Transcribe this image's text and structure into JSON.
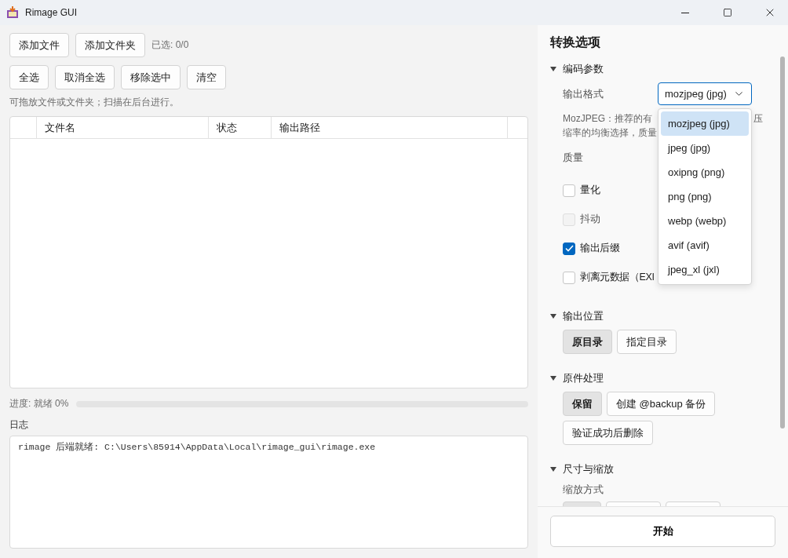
{
  "window": {
    "title": "Rimage GUI"
  },
  "file_toolbar": {
    "buttons": [
      "添加文件",
      "添加文件夹"
    ],
    "selection_count": "已选: 0/0"
  },
  "selection_toolbar": {
    "buttons": [
      "全选",
      "取消全选",
      "移除选中",
      "清空"
    ]
  },
  "hint": "可拖放文件或文件夹；扫描在后台进行。",
  "table": {
    "columns": [
      "文件名",
      "状态",
      "输出路径"
    ]
  },
  "progress": {
    "label": "进度: 就绪 0%",
    "level": 0
  },
  "log": {
    "label": "日志",
    "lines": [
      "rimage 后端就绪: C:\\Users\\85914\\AppData\\Local\\rimage_gui\\rimage.exe"
    ]
  },
  "options": {
    "title": "转换选项",
    "encoding": {
      "title": "编码参数",
      "expanded": true,
      "format": {
        "label": "输出格式",
        "value": "mozjpeg (jpg)",
        "open": true,
        "options": [
          {
            "label": "mozjpeg (jpg)",
            "selected": true
          },
          {
            "label": "jpeg (jpg)",
            "selected": false
          },
          {
            "label": "oxipng (png)",
            "selected": false
          },
          {
            "label": "png (png)",
            "selected": false
          },
          {
            "label": "webp (webp)",
            "selected": false
          },
          {
            "label": "avif (avif)",
            "selected": false
          },
          {
            "label": "jpeg_xl (jxl)",
            "selected": false
          }
        ]
      },
      "description": {
        "lines": [
          "MozJPEG：推荐的有",
          "缩率的均衡选择，质量"
        ],
        "right_fragment": "压"
      },
      "quality_label": "质量",
      "checkboxes": [
        {
          "label": "量化",
          "checked": false,
          "disabled": false
        },
        {
          "label": "抖动",
          "checked": false,
          "disabled": true
        },
        {
          "label": "输出后缀",
          "checked": true,
          "disabled": false
        },
        {
          "label": "剥离元数据（EXI",
          "checked": false,
          "disabled": false
        }
      ]
    },
    "output_location": {
      "title": "输出位置",
      "expanded": true,
      "options": [
        {
          "label": "原目录",
          "selected": true
        },
        {
          "label": "指定目录",
          "selected": false
        }
      ]
    },
    "original_handling": {
      "title": "原件处理",
      "expanded": true,
      "options": [
        {
          "label": "保留",
          "selected": true
        },
        {
          "label": "创建 @backup 备份",
          "selected": false
        },
        {
          "label": "验证成功后删除",
          "selected": false
        }
      ]
    },
    "resize": {
      "title": "尺寸与缩放",
      "expanded": true,
      "mode_label": "缩放方式",
      "options": [
        {
          "selected": true
        },
        {
          "selected": false
        },
        {
          "selected": false
        }
      ]
    }
  },
  "start_button": "开始"
}
